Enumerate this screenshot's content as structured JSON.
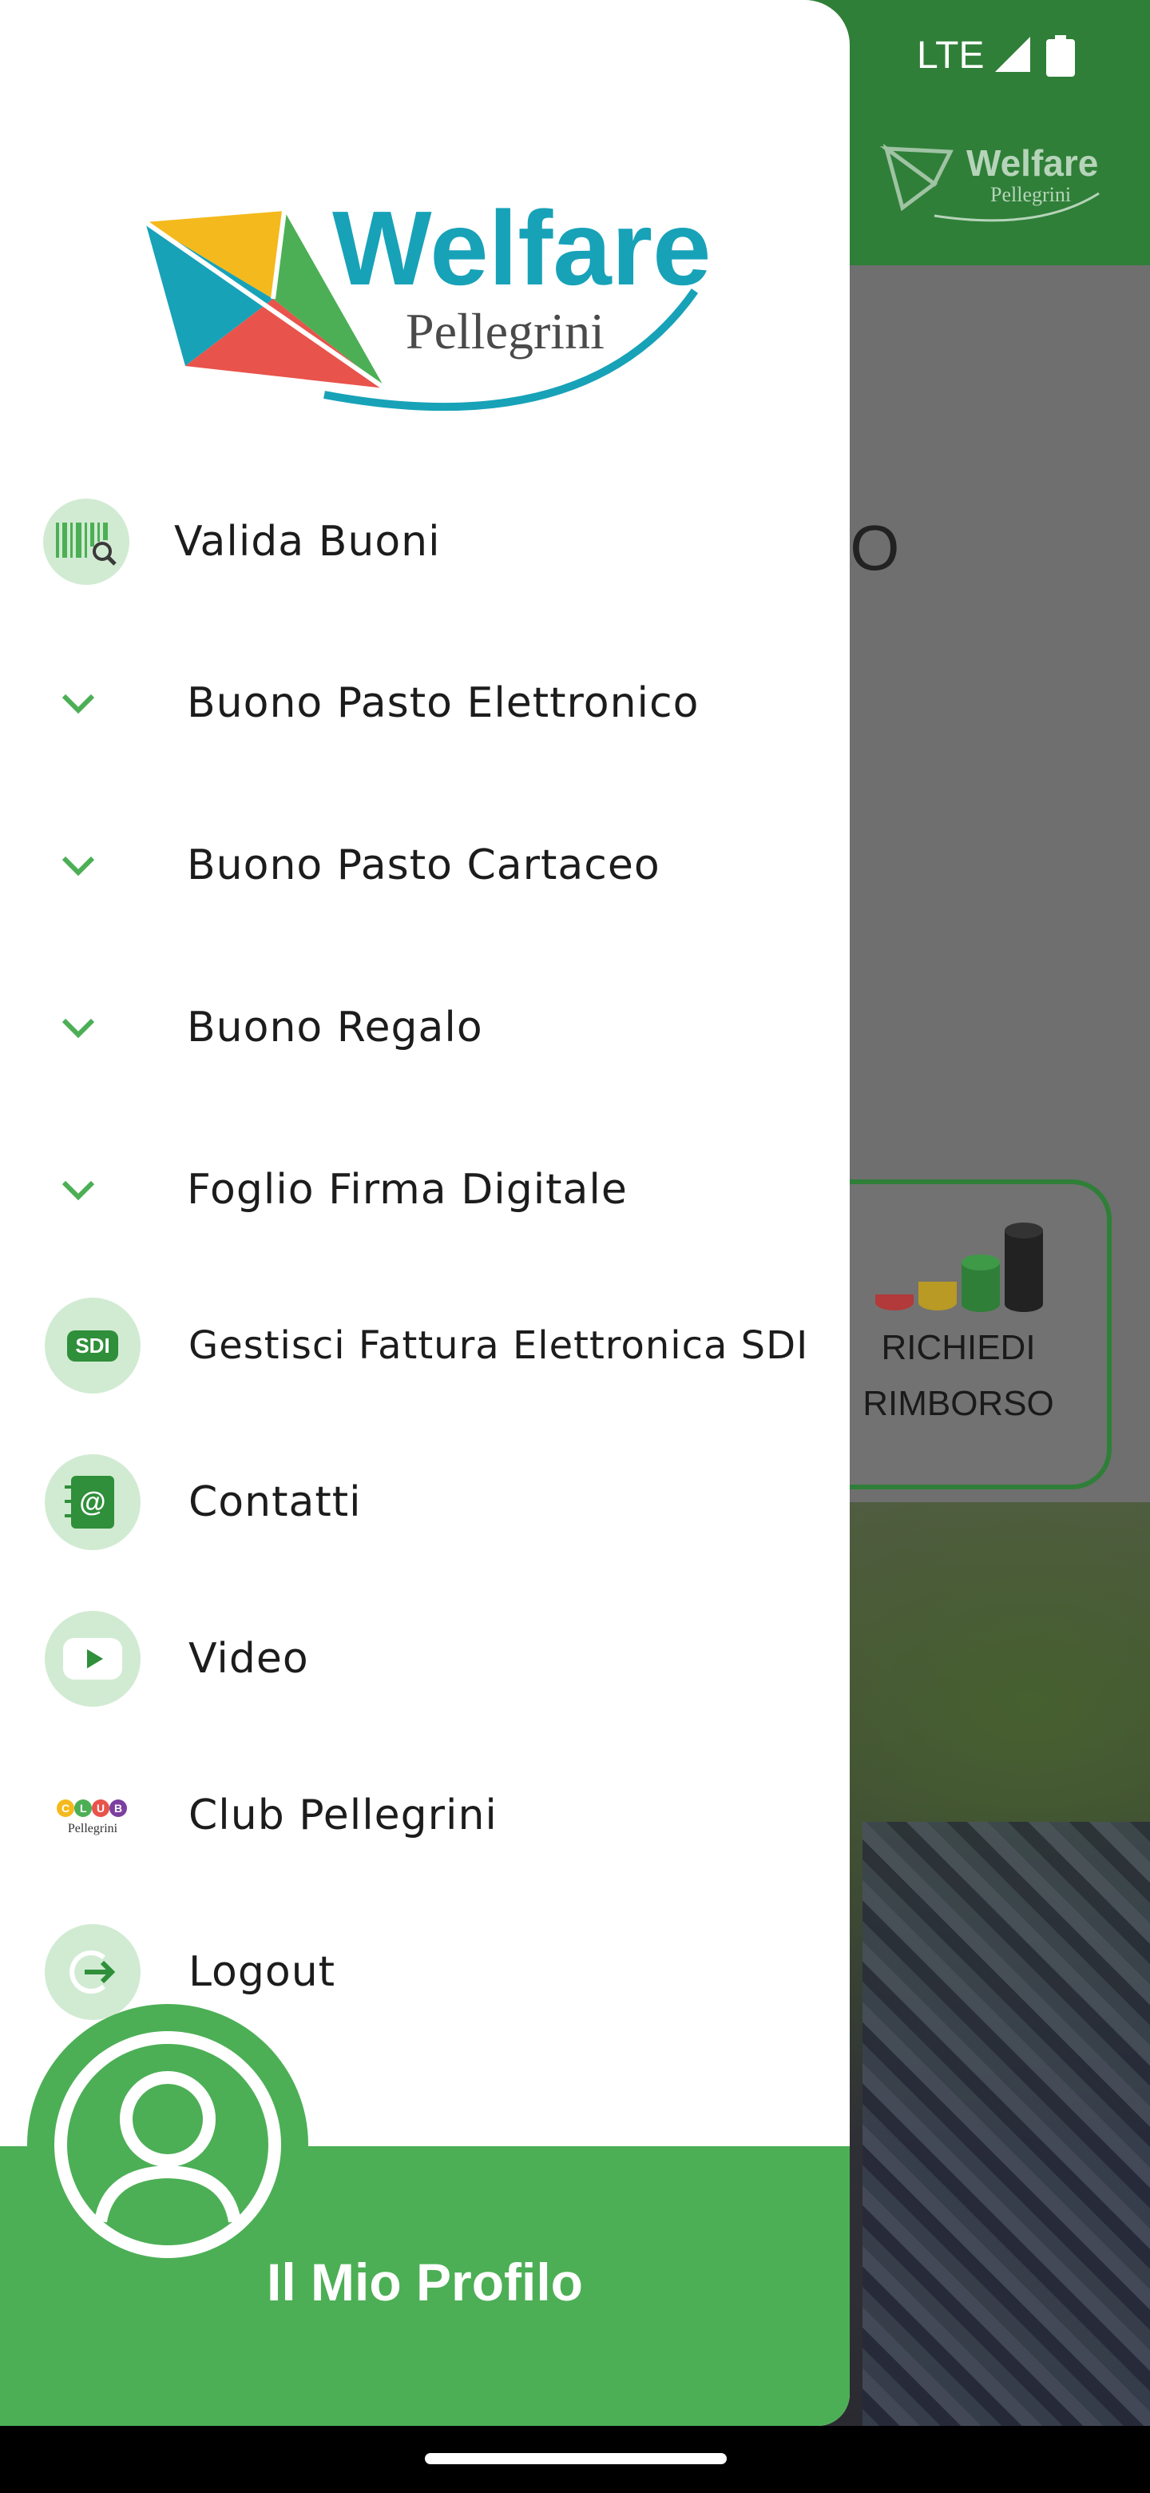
{
  "status_bar": {
    "network": "LTE"
  },
  "background": {
    "logo_title": "Welfare",
    "logo_subtitle": "Pellegrini",
    "fragment_text": "IO",
    "card_line1": "RICHIEDI",
    "card_line2": "RIMBORSO"
  },
  "drawer": {
    "logo": {
      "title": "Welfare",
      "subtitle": "Pellegrini"
    },
    "items": [
      {
        "label": "Valida Buoni",
        "icon": "barcode-search-icon"
      },
      {
        "label": "Buono Pasto Elettronico",
        "icon": "chevron-down-icon"
      },
      {
        "label": "Buono Pasto Cartaceo",
        "icon": "chevron-down-icon"
      },
      {
        "label": "Buono Regalo",
        "icon": "chevron-down-icon"
      },
      {
        "label": "Foglio Firma Digitale",
        "icon": "chevron-down-icon"
      },
      {
        "label": "Gestisci Fattura Elettronica SDI",
        "icon": "sdi-icon",
        "icon_text": "SDI"
      },
      {
        "label": "Contatti",
        "icon": "contact-book-icon",
        "icon_text": "@"
      },
      {
        "label": "Video",
        "icon": "play-icon"
      },
      {
        "label": "Club Pellegrini",
        "icon": "club-pellegrini-logo",
        "icon_text": "Pellegrini",
        "icon_letters": "CLUB"
      },
      {
        "label": "Logout",
        "icon": "logout-icon"
      }
    ],
    "profile_label": "Il Mio Profilo"
  },
  "colors": {
    "brand_green": "#4caf55",
    "header_green": "#2f7f38",
    "icon_bg": "#d1ebd2",
    "teal": "#17a2b8"
  }
}
